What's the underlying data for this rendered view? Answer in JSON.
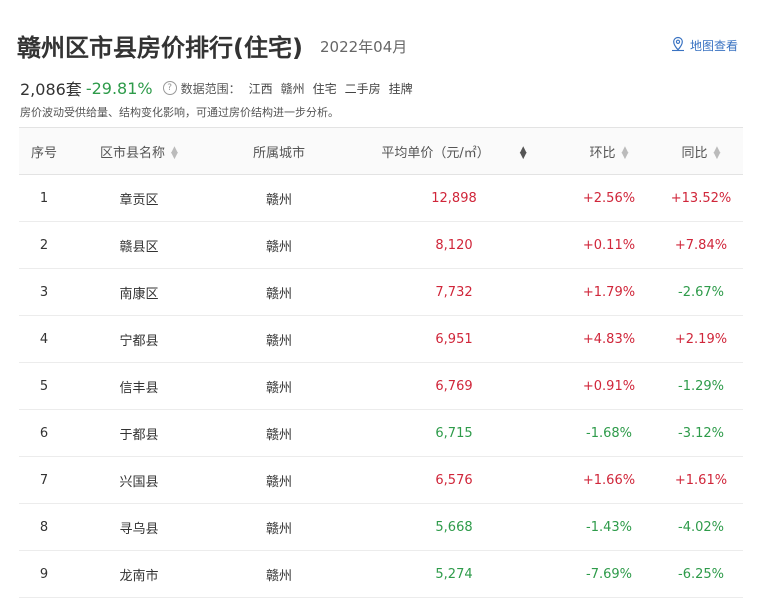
{
  "header": {
    "title": "赣州区市县房价排行(住宅)",
    "date": "2022年04月",
    "map_link": "地图查看",
    "icons": {
      "map": "map-location-icon",
      "help": "help-circle-icon"
    }
  },
  "summary": {
    "count": "2,086套",
    "change": "-29.81%",
    "scope_label": "数据范围：",
    "scope_items": [
      "江西",
      "赣州",
      "住宅",
      "二手房",
      "挂牌"
    ],
    "note": "房价波动受供给量、结构变化影响，可通过房价结构进一步分析。"
  },
  "colors": {
    "up": "#d0263a",
    "down": "#2e9b4a",
    "link": "#3a73c2"
  },
  "table": {
    "headers": [
      "序号",
      "区市县名称",
      "所属城市",
      "平均单价（元/㎡）",
      "环比",
      "同比"
    ],
    "rows": [
      {
        "rank": "1",
        "name": "章贡区",
        "city": "赣州",
        "price": "12,898",
        "mom": "+2.56%",
        "yoy": "+13.52%",
        "price_dir": "up",
        "mom_dir": "up",
        "yoy_dir": "up"
      },
      {
        "rank": "2",
        "name": "赣县区",
        "city": "赣州",
        "price": "8,120",
        "mom": "+0.11%",
        "yoy": "+7.84%",
        "price_dir": "up",
        "mom_dir": "up",
        "yoy_dir": "up"
      },
      {
        "rank": "3",
        "name": "南康区",
        "city": "赣州",
        "price": "7,732",
        "mom": "+1.79%",
        "yoy": "-2.67%",
        "price_dir": "up",
        "mom_dir": "up",
        "yoy_dir": "down"
      },
      {
        "rank": "4",
        "name": "宁都县",
        "city": "赣州",
        "price": "6,951",
        "mom": "+4.83%",
        "yoy": "+2.19%",
        "price_dir": "up",
        "mom_dir": "up",
        "yoy_dir": "up"
      },
      {
        "rank": "5",
        "name": "信丰县",
        "city": "赣州",
        "price": "6,769",
        "mom": "+0.91%",
        "yoy": "-1.29%",
        "price_dir": "up",
        "mom_dir": "up",
        "yoy_dir": "down"
      },
      {
        "rank": "6",
        "name": "于都县",
        "city": "赣州",
        "price": "6,715",
        "mom": "-1.68%",
        "yoy": "-3.12%",
        "price_dir": "down",
        "mom_dir": "down",
        "yoy_dir": "down"
      },
      {
        "rank": "7",
        "name": "兴国县",
        "city": "赣州",
        "price": "6,576",
        "mom": "+1.66%",
        "yoy": "+1.61%",
        "price_dir": "up",
        "mom_dir": "up",
        "yoy_dir": "up"
      },
      {
        "rank": "8",
        "name": "寻乌县",
        "city": "赣州",
        "price": "5,668",
        "mom": "-1.43%",
        "yoy": "-4.02%",
        "price_dir": "down",
        "mom_dir": "down",
        "yoy_dir": "down"
      },
      {
        "rank": "9",
        "name": "龙南市",
        "city": "赣州",
        "price": "5,274",
        "mom": "-7.69%",
        "yoy": "-6.25%",
        "price_dir": "down",
        "mom_dir": "down",
        "yoy_dir": "down"
      }
    ]
  }
}
